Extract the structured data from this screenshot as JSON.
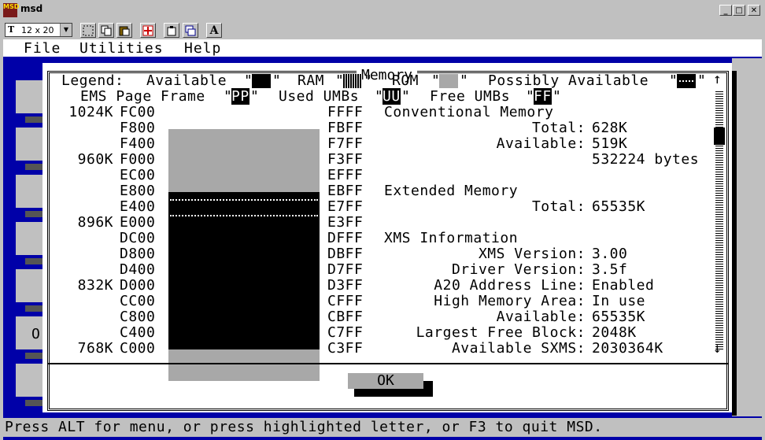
{
  "window": {
    "title": "msd",
    "app_icon_label": "MSD"
  },
  "toolbar": {
    "font_size": "12 x 20"
  },
  "menu": [
    "File",
    "Utilities",
    "Help"
  ],
  "dialog": {
    "title": "Memory",
    "legend": {
      "label": "Legend:",
      "available": "Available",
      "ram": "RAM",
      "rom": "ROM",
      "possibly_available": "Possibly Available",
      "ems_page_frame": "EMS Page Frame",
      "pp": "PP",
      "used_umbs": "Used UMBs",
      "uu": "UU",
      "free_umbs": "Free UMBs",
      "ff": "FF",
      "quote": "\""
    },
    "rows": [
      {
        "k": "1024K",
        "start": "FC00",
        "end": "FFFF"
      },
      {
        "k": "",
        "start": "F800",
        "end": "FBFF"
      },
      {
        "k": "",
        "start": "F400",
        "end": "F7FF"
      },
      {
        "k": "960K",
        "start": "F000",
        "end": "F3FF"
      },
      {
        "k": "",
        "start": "EC00",
        "end": "EFFF"
      },
      {
        "k": "",
        "start": "E800",
        "end": "EBFF"
      },
      {
        "k": "",
        "start": "E400",
        "end": "E7FF"
      },
      {
        "k": "896K",
        "start": "E000",
        "end": "E3FF"
      },
      {
        "k": "",
        "start": "DC00",
        "end": "DFFF"
      },
      {
        "k": "",
        "start": "D800",
        "end": "DBFF"
      },
      {
        "k": "",
        "start": "D400",
        "end": "D7FF"
      },
      {
        "k": "832K",
        "start": "D000",
        "end": "D3FF"
      },
      {
        "k": "",
        "start": "CC00",
        "end": "CFFF"
      },
      {
        "k": "",
        "start": "C800",
        "end": "CBFF"
      },
      {
        "k": "",
        "start": "C400",
        "end": "C7FF"
      },
      {
        "k": "768K",
        "start": "C000",
        "end": "C3FF"
      }
    ],
    "info": [
      {
        "label": "Conventional Memory",
        "value": "",
        "heading": true
      },
      {
        "label": "Total:",
        "value": "628K"
      },
      {
        "label": "Available:",
        "value": "519K"
      },
      {
        "label": "",
        "value": "532224 bytes"
      },
      {
        "label": "",
        "value": ""
      },
      {
        "label": "Extended Memory",
        "value": "",
        "heading": true
      },
      {
        "label": "Total:",
        "value": "65535K"
      },
      {
        "label": "",
        "value": ""
      },
      {
        "label": "XMS Information",
        "value": "",
        "heading": true
      },
      {
        "label": "XMS Version:",
        "value": "3.00"
      },
      {
        "label": "Driver Version:",
        "value": "3.5f"
      },
      {
        "label": "A20 Address Line:",
        "value": "Enabled"
      },
      {
        "label": "High Memory Area:",
        "value": "In use"
      },
      {
        "label": "Available:",
        "value": "65535K"
      },
      {
        "label": "Largest Free Block:",
        "value": "2048K"
      },
      {
        "label": "Available SXMS:",
        "value": "2030364K"
      }
    ],
    "scroll_up": "↑",
    "scroll_down": "↓",
    "ok_label": "OK"
  },
  "background_letter": "O",
  "status": "Press ALT for menu, or press highlighted letter, or F3 to quit MSD."
}
